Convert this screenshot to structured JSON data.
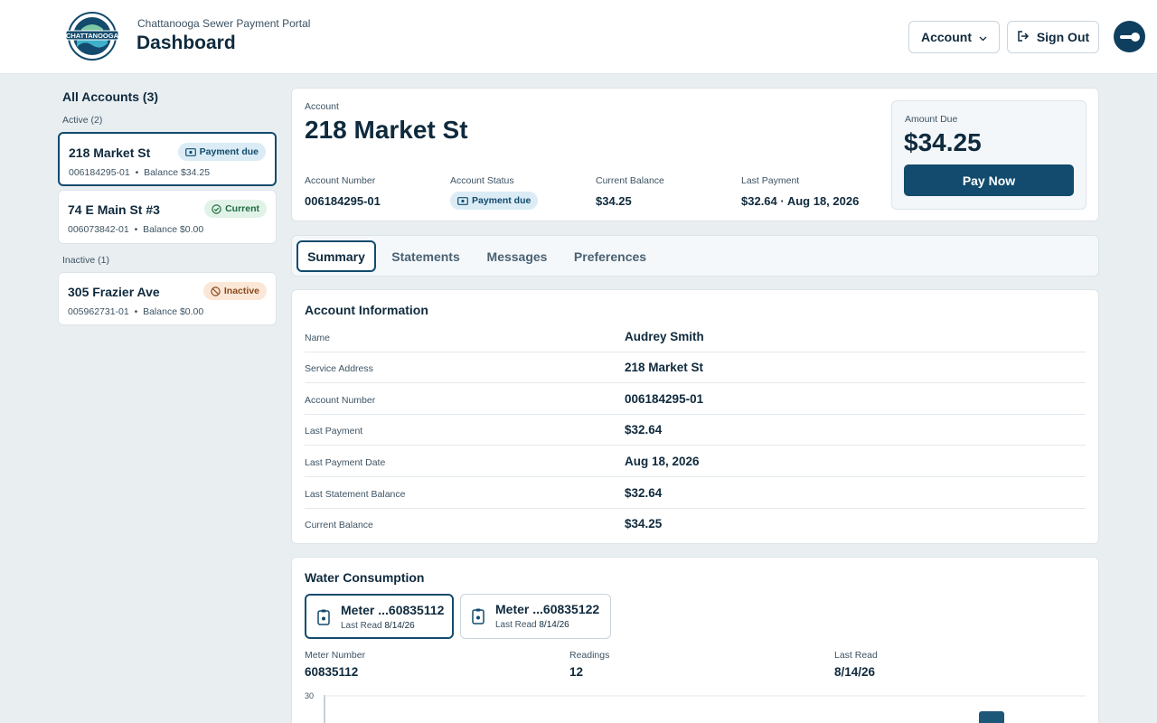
{
  "header": {
    "portal_name": "Chattanooga Sewer Payment Portal",
    "title": "Dashboard",
    "account_label": "Account",
    "sign_out_label": "Sign Out",
    "logo_text": "CHATTANOOGA"
  },
  "sidebar": {
    "title": "All Accounts (3)",
    "active_label": "Active (2)",
    "inactive_label": "Inactive (1)",
    "accounts": [
      {
        "name": "218 Market St",
        "number": "006184295-01",
        "balance": "Balance $34.25",
        "status": "Payment due"
      },
      {
        "name": "74 E Main St #3",
        "number": "006073842-01",
        "balance": "Balance $0.00",
        "status": "Current"
      },
      {
        "name": "305 Frazier Ave",
        "number": "005962731-01",
        "balance": "Balance $0.00",
        "status": "Inactive"
      }
    ]
  },
  "overview": {
    "label": "Account",
    "title": "218 Market St",
    "fields": [
      {
        "label": "Account Number",
        "value": "006184295-01"
      },
      {
        "label": "Account Status",
        "value": "Payment due"
      },
      {
        "label": "Current Balance",
        "value": "$34.25"
      },
      {
        "label": "Last Payment",
        "value": "$32.64 · Aug 18, 2026"
      }
    ],
    "amount_due_label": "Amount Due",
    "amount_due": "$34.25",
    "pay_label": "Pay Now"
  },
  "tabs": [
    "Summary",
    "Statements",
    "Messages",
    "Preferences"
  ],
  "account_info": {
    "title": "Account Information",
    "rows": [
      {
        "label": "Name",
        "value": "Audrey Smith"
      },
      {
        "label": "Service Address",
        "value": "218 Market St"
      },
      {
        "label": "Account Number",
        "value": "006184295-01"
      },
      {
        "label": "Last Payment",
        "value": "$32.64"
      },
      {
        "label": "Last Payment Date",
        "value": "Aug 18, 2026"
      },
      {
        "label": "Last Statement Balance",
        "value": "$32.64"
      },
      {
        "label": "Current Balance",
        "value": "$34.25"
      }
    ]
  },
  "water": {
    "title": "Water Consumption",
    "meters": [
      {
        "name": "Meter ...60835112",
        "read_label": "Last Read",
        "read_date": "8/14/26"
      },
      {
        "name": "Meter ...60835122",
        "read_label": "Last Read",
        "read_date": "8/14/26"
      }
    ],
    "stats": [
      {
        "label": "Meter Number",
        "value": "60835112"
      },
      {
        "label": "Readings",
        "value": "12"
      },
      {
        "label": "Last Read",
        "value": "8/14/26"
      }
    ],
    "chart_y_max_label": "30"
  },
  "colors": {
    "primary": "#124b6d",
    "page_bg": "#e9eef1",
    "badge_due": "#dbecf6",
    "badge_current": "#e1f3e8",
    "badge_inactive": "#fbe7d7"
  }
}
